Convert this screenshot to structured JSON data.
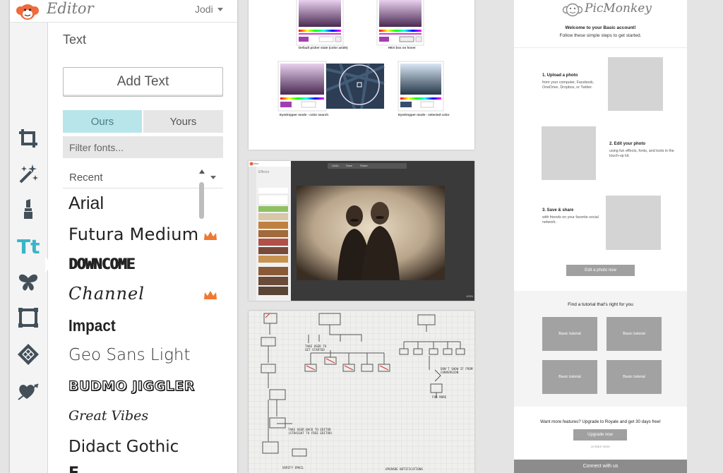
{
  "editor": {
    "app_title": "Editor",
    "user_name": "Jodi",
    "panel_title": "Text",
    "add_text_label": "Add Text",
    "tabs": [
      {
        "label": "Ours",
        "active": true
      },
      {
        "label": "Yours",
        "active": false
      }
    ],
    "filter_placeholder": "Filter fonts...",
    "font_category": "Recent",
    "active_tool": "text",
    "tools": [
      "crop-icon",
      "effects-wand-icon",
      "touchup-lipstick-icon",
      "text-icon",
      "overlays-butterfly-icon",
      "frames-icon",
      "textures-icon",
      "themes-heart-arrow-icon"
    ],
    "fonts": [
      {
        "name": "Arial",
        "premium": false
      },
      {
        "name": "Futura Medium",
        "premium": true
      },
      {
        "name": "DOWNCOME",
        "premium": false
      },
      {
        "name": "Channel",
        "premium": true
      },
      {
        "name": "Impact",
        "premium": false
      },
      {
        "name": "Geo Sans Light",
        "premium": false
      },
      {
        "name": "BUDMO JIGGLER",
        "premium": false
      },
      {
        "name": "Great Vibes",
        "premium": false
      },
      {
        "name": "Didact Gothic",
        "premium": false
      }
    ],
    "accent_color": "#3ab5c7",
    "logo_color": "#ef6b3c",
    "premium_color": "#f07830"
  },
  "mockups": {
    "color_picker": {
      "captions": [
        "Default picker state (color aside)",
        "HEX box on hover",
        "Eyedropper mode - color search",
        "Eyedropper mode - selected color"
      ],
      "hex_values": [
        "8B42DB",
        "8B42DB",
        "8B42DB",
        "374D6D"
      ]
    },
    "editor_screenshot": {
      "title": "Editor",
      "panel": "Effects",
      "toolbar": [
        "Undo",
        "Save",
        "Share"
      ],
      "zoom": "100%"
    },
    "sketch": {
      "notes": [
        "VERIFY EMAIL",
        "UPGRADE NOTIFICATIONS",
        "TAKE USER TO GET STARTED",
        "TAKE USER BACK TO EDITOR (STRAIGHT TO FREE EDITOR)",
        "DON'T SHOW IF FROM CONVERSION",
        "FOR MORE"
      ]
    }
  },
  "email": {
    "brand": "PicMonkey",
    "welcome": "Welcome to your Basic account!",
    "follow": "Follow these simple steps to get started.",
    "steps": [
      {
        "title": "1. Upload a photo",
        "desc": "from your computer, Facebook, OneDrive, Dropbox, or Twitter."
      },
      {
        "title": "2. Edit your photo",
        "desc": "using fun effects, fonts, and tools in the touch-up kit."
      },
      {
        "title": "3. Save & share",
        "desc": "with friends on your favorite social network."
      }
    ],
    "cta": "Edit a photo now",
    "tutorial_heading": "Find a tutorial that's right for you",
    "tutorials": [
      "Basic tutorial",
      "Basic tutorial",
      "Basic tutorial",
      "Basic tutorial"
    ],
    "upgrade_text": "Want more features? Upgrade to Royale and get 30 days free!",
    "upgrade_button": "Upgrade now",
    "learn_more": "or learn more",
    "footer": "Connect with us"
  }
}
